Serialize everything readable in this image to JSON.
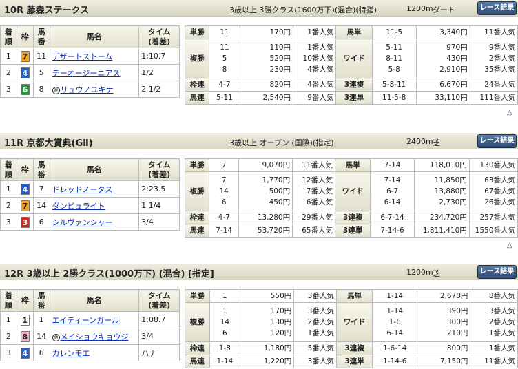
{
  "races": [
    {
      "title": "10R 藤森ステークス",
      "condition": "3歳以上 3勝クラス(1600万下)(混合)(特指)",
      "distance": "1200m",
      "surface": "ダート",
      "button": "レース結果",
      "headers": {
        "rank": "着\n順",
        "frame": "枠",
        "num": "馬\n番",
        "name": "馬名",
        "time": "タイム\n(着差)"
      },
      "results": [
        {
          "rank": "1",
          "frame": "7",
          "frame_bg": "#f4a11c",
          "frame_fg": "#222",
          "num": "11",
          "name": "デザートストーム",
          "mark": "",
          "time": "1:10.7"
        },
        {
          "rank": "2",
          "frame": "4",
          "frame_bg": "#1d5fd1",
          "frame_fg": "#fff",
          "num": "5",
          "name": "テーオージーニアス",
          "mark": "",
          "time": "1/2"
        },
        {
          "rank": "3",
          "frame": "6",
          "frame_bg": "#1f9a3a",
          "frame_fg": "#fff",
          "num": "8",
          "name": "リュウノユキナ",
          "mark": "地",
          "time": "2 1/2"
        }
      ],
      "payouts": {
        "tansho": {
          "label": "単勝",
          "nums": [
            "11"
          ],
          "yen": [
            "170円"
          ],
          "pop": [
            "1番人気"
          ]
        },
        "fukusho": {
          "label": "複勝",
          "nums": [
            "11",
            "5",
            "8"
          ],
          "yen": [
            "110円",
            "520円",
            "230円"
          ],
          "pop": [
            "1番人気",
            "10番人気",
            "4番人気"
          ]
        },
        "wakuren": {
          "label": "枠連",
          "nums": [
            "4-7"
          ],
          "yen": [
            "820円"
          ],
          "pop": [
            "4番人気"
          ]
        },
        "umaren": {
          "label": "馬連",
          "nums": [
            "5-11"
          ],
          "yen": [
            "2,540円"
          ],
          "pop": [
            "9番人気"
          ]
        },
        "umatan": {
          "label": "馬単",
          "nums": [
            "11-5"
          ],
          "yen": [
            "3,340円"
          ],
          "pop": [
            "11番人気"
          ]
        },
        "wide": {
          "label": "ワイド",
          "nums": [
            "5-11",
            "8-11",
            "5-8"
          ],
          "yen": [
            "970円",
            "430円",
            "2,910円"
          ],
          "pop": [
            "9番人気",
            "2番人気",
            "35番人気"
          ]
        },
        "sanrenpuku": {
          "label": "3連複",
          "nums": [
            "5-8-11"
          ],
          "yen": [
            "6,670円"
          ],
          "pop": [
            "24番人気"
          ]
        },
        "sanrentan": {
          "label": "3連単",
          "nums": [
            "11-5-8"
          ],
          "yen": [
            "33,110円"
          ],
          "pop": [
            "111番人気"
          ]
        }
      }
    },
    {
      "title": "11R 京都大賞典(GⅡ)",
      "condition": "3歳以上 オープン (国際)(指定)",
      "distance": "2400m",
      "surface": "芝",
      "button": "レース結果",
      "headers": {
        "rank": "着\n順",
        "frame": "枠",
        "num": "馬\n番",
        "name": "馬名",
        "time": "タイム\n(着差)"
      },
      "results": [
        {
          "rank": "1",
          "frame": "4",
          "frame_bg": "#1d5fd1",
          "frame_fg": "#fff",
          "num": "7",
          "name": "ドレッドノータス",
          "mark": "",
          "time": "2:23.5"
        },
        {
          "rank": "2",
          "frame": "7",
          "frame_bg": "#f4a11c",
          "frame_fg": "#222",
          "num": "14",
          "name": "ダンビュライト",
          "mark": "",
          "time": "1 1/4"
        },
        {
          "rank": "3",
          "frame": "3",
          "frame_bg": "#e0231c",
          "frame_fg": "#fff",
          "num": "6",
          "name": "シルヴァンシャー",
          "mark": "",
          "time": "3/4"
        }
      ],
      "payouts": {
        "tansho": {
          "label": "単勝",
          "nums": [
            "7"
          ],
          "yen": [
            "9,070円"
          ],
          "pop": [
            "11番人気"
          ]
        },
        "fukusho": {
          "label": "複勝",
          "nums": [
            "7",
            "14",
            "6"
          ],
          "yen": [
            "1,770円",
            "500円",
            "450円"
          ],
          "pop": [
            "12番人気",
            "7番人気",
            "6番人気"
          ]
        },
        "wakuren": {
          "label": "枠連",
          "nums": [
            "4-7"
          ],
          "yen": [
            "13,280円"
          ],
          "pop": [
            "29番人気"
          ]
        },
        "umaren": {
          "label": "馬連",
          "nums": [
            "7-14"
          ],
          "yen": [
            "53,720円"
          ],
          "pop": [
            "65番人気"
          ]
        },
        "umatan": {
          "label": "馬単",
          "nums": [
            "7-14"
          ],
          "yen": [
            "118,010円"
          ],
          "pop": [
            "130番人気"
          ]
        },
        "wide": {
          "label": "ワイド",
          "nums": [
            "7-14",
            "6-7",
            "6-14"
          ],
          "yen": [
            "11,850円",
            "13,880円",
            "2,730円"
          ],
          "pop": [
            "63番人気",
            "67番人気",
            "26番人気"
          ]
        },
        "sanrenpuku": {
          "label": "3連複",
          "nums": [
            "6-7-14"
          ],
          "yen": [
            "234,720円"
          ],
          "pop": [
            "257番人気"
          ]
        },
        "sanrentan": {
          "label": "3連単",
          "nums": [
            "7-14-6"
          ],
          "yen": [
            "1,811,410円"
          ],
          "pop": [
            "1550番人気"
          ]
        }
      }
    },
    {
      "title": "12R 3歳以上 2勝クラス(1000万下) (混合) [指定]",
      "condition": "",
      "distance": "1200m",
      "surface": "芝",
      "button": "レース結果",
      "headers": {
        "rank": "着\n順",
        "frame": "枠",
        "num": "馬\n番",
        "name": "馬名",
        "time": "タイム\n(着差)"
      },
      "results": [
        {
          "rank": "1",
          "frame": "1",
          "frame_bg": "#ffffff",
          "frame_fg": "#222",
          "num": "1",
          "name": "エイティーンガール",
          "mark": "",
          "time": "1:08.7"
        },
        {
          "rank": "2",
          "frame": "8",
          "frame_bg": "#f6b9c9",
          "frame_fg": "#222",
          "num": "14",
          "name": "メイショウキョウジ",
          "mark": "地",
          "time": "3/4"
        },
        {
          "rank": "3",
          "frame": "4",
          "frame_bg": "#1d5fd1",
          "frame_fg": "#fff",
          "num": "6",
          "name": "カレンモエ",
          "mark": "",
          "time": "ハナ"
        }
      ],
      "payouts": {
        "tansho": {
          "label": "単勝",
          "nums": [
            "1"
          ],
          "yen": [
            "550円"
          ],
          "pop": [
            "3番人気"
          ]
        },
        "fukusho": {
          "label": "複勝",
          "nums": [
            "1",
            "14",
            "6"
          ],
          "yen": [
            "170円",
            "130円",
            "120円"
          ],
          "pop": [
            "3番人気",
            "2番人気",
            "1番人気"
          ]
        },
        "wakuren": {
          "label": "枠連",
          "nums": [
            "1-8"
          ],
          "yen": [
            "1,180円"
          ],
          "pop": [
            "5番人気"
          ]
        },
        "umaren": {
          "label": "馬連",
          "nums": [
            "1-14"
          ],
          "yen": [
            "1,220円"
          ],
          "pop": [
            "3番人気"
          ]
        },
        "umatan": {
          "label": "馬単",
          "nums": [
            "1-14"
          ],
          "yen": [
            "2,670円"
          ],
          "pop": [
            "8番人気"
          ]
        },
        "wide": {
          "label": "ワイド",
          "nums": [
            "1-14",
            "1-6",
            "6-14"
          ],
          "yen": [
            "390円",
            "300円",
            "210円"
          ],
          "pop": [
            "3番人気",
            "2番人気",
            "1番人気"
          ]
        },
        "sanrenpuku": {
          "label": "3連複",
          "nums": [
            "1-6-14"
          ],
          "yen": [
            "800円"
          ],
          "pop": [
            "1番人気"
          ]
        },
        "sanrentan": {
          "label": "3連単",
          "nums": [
            "1-14-6"
          ],
          "yen": [
            "7,150円"
          ],
          "pop": [
            "11番人気"
          ]
        }
      }
    }
  ],
  "back_to_top_glyph": "△"
}
